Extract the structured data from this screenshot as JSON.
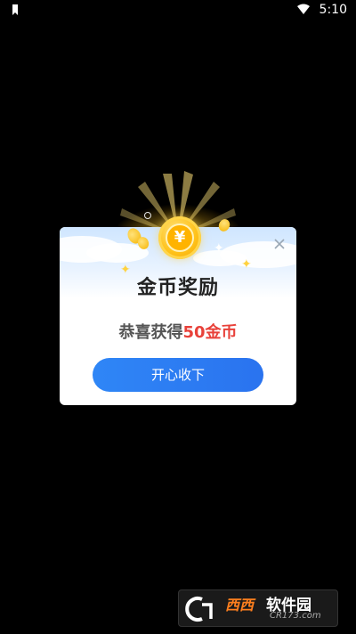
{
  "status_bar": {
    "time": "5:10"
  },
  "dialog": {
    "title": "金币奖励",
    "message_prefix": "恭喜获得",
    "message_highlight": "50金币",
    "confirm_label": "开心收下",
    "coin_symbol": "¥"
  },
  "watermark": {
    "brand_latin": "CR",
    "brand_cn_mark": "西西",
    "brand_cn": "软件园",
    "site": "CR173.com"
  },
  "colors": {
    "background": "#000000",
    "accent_button": "#2f86f6",
    "highlight_text": "#e8413a",
    "coin_gold": "#ffc21a"
  }
}
